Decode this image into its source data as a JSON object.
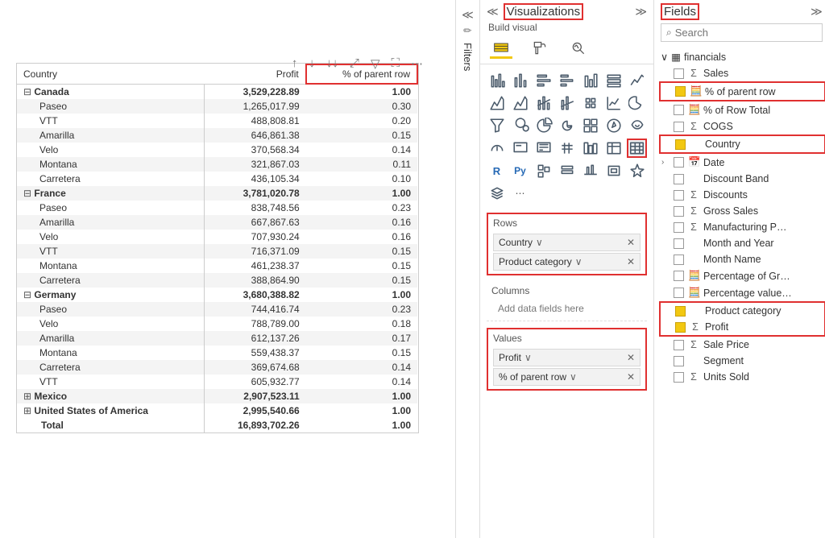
{
  "matrix": {
    "headers": [
      "Country",
      "Profit",
      "% of parent row"
    ],
    "groups": [
      {
        "name": "Canada",
        "profit": "3,529,228.89",
        "pct": "1.00",
        "open": true,
        "rows": [
          {
            "name": "Paseo",
            "profit": "1,265,017.99",
            "pct": "0.30"
          },
          {
            "name": "VTT",
            "profit": "488,808.81",
            "pct": "0.20"
          },
          {
            "name": "Amarilla",
            "profit": "646,861.38",
            "pct": "0.15"
          },
          {
            "name": "Velo",
            "profit": "370,568.34",
            "pct": "0.14"
          },
          {
            "name": "Montana",
            "profit": "321,867.03",
            "pct": "0.11"
          },
          {
            "name": "Carretera",
            "profit": "436,105.34",
            "pct": "0.10"
          }
        ]
      },
      {
        "name": "France",
        "profit": "3,781,020.78",
        "pct": "1.00",
        "open": true,
        "rows": [
          {
            "name": "Paseo",
            "profit": "838,748.56",
            "pct": "0.23"
          },
          {
            "name": "Amarilla",
            "profit": "667,867.63",
            "pct": "0.16"
          },
          {
            "name": "Velo",
            "profit": "707,930.24",
            "pct": "0.16"
          },
          {
            "name": "VTT",
            "profit": "716,371.09",
            "pct": "0.15"
          },
          {
            "name": "Montana",
            "profit": "461,238.37",
            "pct": "0.15"
          },
          {
            "name": "Carretera",
            "profit": "388,864.90",
            "pct": "0.15"
          }
        ]
      },
      {
        "name": "Germany",
        "profit": "3,680,388.82",
        "pct": "1.00",
        "open": true,
        "rows": [
          {
            "name": "Paseo",
            "profit": "744,416.74",
            "pct": "0.23"
          },
          {
            "name": "Velo",
            "profit": "788,789.00",
            "pct": "0.18"
          },
          {
            "name": "Amarilla",
            "profit": "612,137.26",
            "pct": "0.17"
          },
          {
            "name": "Montana",
            "profit": "559,438.37",
            "pct": "0.15"
          },
          {
            "name": "Carretera",
            "profit": "369,674.68",
            "pct": "0.14"
          },
          {
            "name": "VTT",
            "profit": "605,932.77",
            "pct": "0.14"
          }
        ]
      },
      {
        "name": "Mexico",
        "profit": "2,907,523.11",
        "pct": "1.00",
        "open": false,
        "rows": []
      },
      {
        "name": "United States of America",
        "profit": "2,995,540.66",
        "pct": "1.00",
        "open": false,
        "rows": []
      }
    ],
    "total": {
      "label": "Total",
      "profit": "16,893,702.26",
      "pct": "1.00"
    }
  },
  "panels": {
    "viz_title": "Visualizations",
    "fields_title": "Fields",
    "build_label": "Build visual",
    "rows_label": "Rows",
    "columns_label": "Columns",
    "values_label": "Values",
    "add_fields": "Add data fields here",
    "search_placeholder": "Search"
  },
  "wells": {
    "rows": [
      "Country",
      "Product category"
    ],
    "values": [
      "Profit",
      "% of parent row"
    ]
  },
  "filters_label": "Filters",
  "fields": {
    "table": "financials",
    "items": [
      {
        "name": "Sales",
        "icon": "Σ",
        "checked": false,
        "hl": false
      },
      {
        "name": "% of parent row",
        "icon": "calc",
        "checked": true,
        "hl": true
      },
      {
        "name": "% of Row Total",
        "icon": "calc",
        "checked": false,
        "hl": false
      },
      {
        "name": "COGS",
        "icon": "Σ",
        "checked": false,
        "hl": false
      },
      {
        "name": "Country",
        "icon": "",
        "checked": true,
        "hl": true
      },
      {
        "name": "Date",
        "icon": "date",
        "checked": false,
        "hl": false,
        "expandable": true
      },
      {
        "name": "Discount Band",
        "icon": "",
        "checked": false,
        "hl": false
      },
      {
        "name": "Discounts",
        "icon": "Σ",
        "checked": false,
        "hl": false
      },
      {
        "name": "Gross Sales",
        "icon": "Σ",
        "checked": false,
        "hl": false
      },
      {
        "name": "Manufacturing P…",
        "icon": "Σ",
        "checked": false,
        "hl": false
      },
      {
        "name": "Month and Year",
        "icon": "",
        "checked": false,
        "hl": false
      },
      {
        "name": "Month Name",
        "icon": "",
        "checked": false,
        "hl": false
      },
      {
        "name": "Percentage of Gr…",
        "icon": "calc",
        "checked": false,
        "hl": false
      },
      {
        "name": "Percentage value…",
        "icon": "calc",
        "checked": false,
        "hl": false
      },
      {
        "name": "Product category",
        "icon": "",
        "checked": true,
        "hl": true
      },
      {
        "name": "Profit",
        "icon": "Σ",
        "checked": true,
        "hl": true
      },
      {
        "name": "Sale Price",
        "icon": "Σ",
        "checked": false,
        "hl": false
      },
      {
        "name": "Segment",
        "icon": "",
        "checked": false,
        "hl": false
      },
      {
        "name": "Units Sold",
        "icon": "Σ",
        "checked": false,
        "hl": false
      }
    ]
  }
}
